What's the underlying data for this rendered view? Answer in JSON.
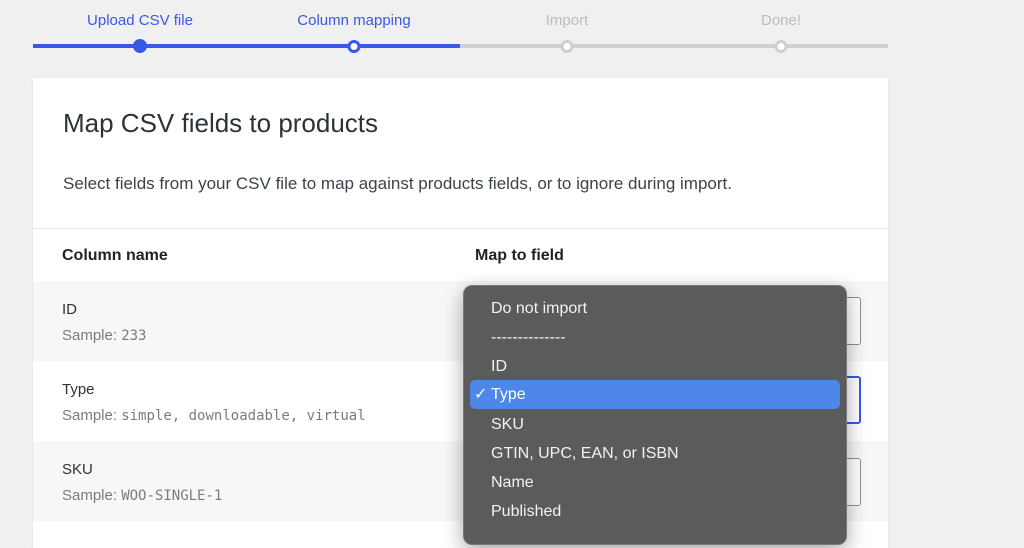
{
  "steps": [
    {
      "label": "Upload CSV file",
      "state": "done"
    },
    {
      "label": "Column mapping",
      "state": "current"
    },
    {
      "label": "Import",
      "state": "todo"
    },
    {
      "label": "Done!",
      "state": "todo"
    }
  ],
  "card": {
    "title": "Map CSV fields to products",
    "description": "Select fields from your CSV file to map against products fields, or to ignore during import.",
    "col_name_header": "Column name",
    "col_map_header": "Map to field"
  },
  "rows": [
    {
      "name": "ID",
      "sample_label": "Sample:",
      "sample_value": "233"
    },
    {
      "name": "Type",
      "sample_label": "Sample:",
      "sample_value": "simple, downloadable, virtual"
    },
    {
      "name": "SKU",
      "sample_label": "Sample:",
      "sample_value": "WOO-SINGLE-1"
    }
  ],
  "dropdown": {
    "options": [
      "Do not import",
      "--------------",
      "ID",
      "Type",
      "SKU",
      "GTIN, UPC, EAN, or ISBN",
      "Name",
      "Published"
    ],
    "selected": "Type",
    "check_glyph": "✓"
  },
  "colors": {
    "accent": "#3858e9",
    "dropdown_bg": "#5b5b5b",
    "dropdown_selected": "#4d87e8"
  }
}
